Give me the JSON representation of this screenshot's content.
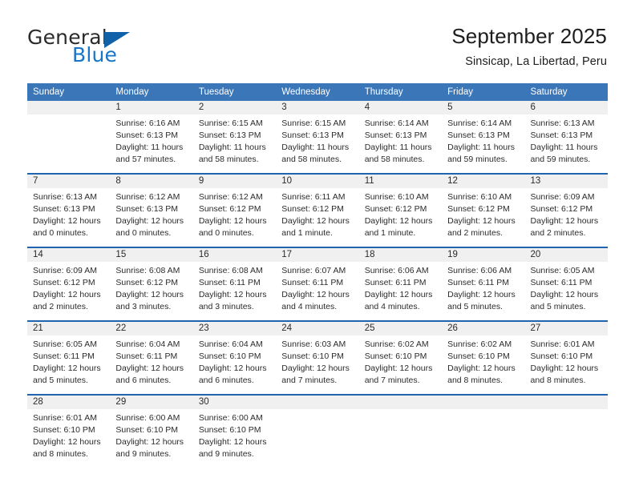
{
  "brand": {
    "line1": "General",
    "line2": "Blue",
    "logo_blue": "#1061a8",
    "logo_text_blue": "#1876c8",
    "logo_text_dark": "#2b2b2b"
  },
  "header": {
    "title": "September 2025",
    "subtitle": "Sinsicap, La Libertad, Peru"
  },
  "theme": {
    "header_row_bg": "#3b77b8",
    "header_row_text": "#ffffff",
    "week_rule": "#1f64ac",
    "day_number_band": "#f0f0f0",
    "body_text": "#2b2b2b"
  },
  "weekdays": [
    "Sunday",
    "Monday",
    "Tuesday",
    "Wednesday",
    "Thursday",
    "Friday",
    "Saturday"
  ],
  "weeks": [
    [
      {
        "day": "",
        "lines": []
      },
      {
        "day": "1",
        "lines": [
          "Sunrise: 6:16 AM",
          "Sunset: 6:13 PM",
          "Daylight: 11 hours",
          "and 57 minutes."
        ]
      },
      {
        "day": "2",
        "lines": [
          "Sunrise: 6:15 AM",
          "Sunset: 6:13 PM",
          "Daylight: 11 hours",
          "and 58 minutes."
        ]
      },
      {
        "day": "3",
        "lines": [
          "Sunrise: 6:15 AM",
          "Sunset: 6:13 PM",
          "Daylight: 11 hours",
          "and 58 minutes."
        ]
      },
      {
        "day": "4",
        "lines": [
          "Sunrise: 6:14 AM",
          "Sunset: 6:13 PM",
          "Daylight: 11 hours",
          "and 58 minutes."
        ]
      },
      {
        "day": "5",
        "lines": [
          "Sunrise: 6:14 AM",
          "Sunset: 6:13 PM",
          "Daylight: 11 hours",
          "and 59 minutes."
        ]
      },
      {
        "day": "6",
        "lines": [
          "Sunrise: 6:13 AM",
          "Sunset: 6:13 PM",
          "Daylight: 11 hours",
          "and 59 minutes."
        ]
      }
    ],
    [
      {
        "day": "7",
        "lines": [
          "Sunrise: 6:13 AM",
          "Sunset: 6:13 PM",
          "Daylight: 12 hours",
          "and 0 minutes."
        ]
      },
      {
        "day": "8",
        "lines": [
          "Sunrise: 6:12 AM",
          "Sunset: 6:13 PM",
          "Daylight: 12 hours",
          "and 0 minutes."
        ]
      },
      {
        "day": "9",
        "lines": [
          "Sunrise: 6:12 AM",
          "Sunset: 6:12 PM",
          "Daylight: 12 hours",
          "and 0 minutes."
        ]
      },
      {
        "day": "10",
        "lines": [
          "Sunrise: 6:11 AM",
          "Sunset: 6:12 PM",
          "Daylight: 12 hours",
          "and 1 minute."
        ]
      },
      {
        "day": "11",
        "lines": [
          "Sunrise: 6:10 AM",
          "Sunset: 6:12 PM",
          "Daylight: 12 hours",
          "and 1 minute."
        ]
      },
      {
        "day": "12",
        "lines": [
          "Sunrise: 6:10 AM",
          "Sunset: 6:12 PM",
          "Daylight: 12 hours",
          "and 2 minutes."
        ]
      },
      {
        "day": "13",
        "lines": [
          "Sunrise: 6:09 AM",
          "Sunset: 6:12 PM",
          "Daylight: 12 hours",
          "and 2 minutes."
        ]
      }
    ],
    [
      {
        "day": "14",
        "lines": [
          "Sunrise: 6:09 AM",
          "Sunset: 6:12 PM",
          "Daylight: 12 hours",
          "and 2 minutes."
        ]
      },
      {
        "day": "15",
        "lines": [
          "Sunrise: 6:08 AM",
          "Sunset: 6:12 PM",
          "Daylight: 12 hours",
          "and 3 minutes."
        ]
      },
      {
        "day": "16",
        "lines": [
          "Sunrise: 6:08 AM",
          "Sunset: 6:11 PM",
          "Daylight: 12 hours",
          "and 3 minutes."
        ]
      },
      {
        "day": "17",
        "lines": [
          "Sunrise: 6:07 AM",
          "Sunset: 6:11 PM",
          "Daylight: 12 hours",
          "and 4 minutes."
        ]
      },
      {
        "day": "18",
        "lines": [
          "Sunrise: 6:06 AM",
          "Sunset: 6:11 PM",
          "Daylight: 12 hours",
          "and 4 minutes."
        ]
      },
      {
        "day": "19",
        "lines": [
          "Sunrise: 6:06 AM",
          "Sunset: 6:11 PM",
          "Daylight: 12 hours",
          "and 5 minutes."
        ]
      },
      {
        "day": "20",
        "lines": [
          "Sunrise: 6:05 AM",
          "Sunset: 6:11 PM",
          "Daylight: 12 hours",
          "and 5 minutes."
        ]
      }
    ],
    [
      {
        "day": "21",
        "lines": [
          "Sunrise: 6:05 AM",
          "Sunset: 6:11 PM",
          "Daylight: 12 hours",
          "and 5 minutes."
        ]
      },
      {
        "day": "22",
        "lines": [
          "Sunrise: 6:04 AM",
          "Sunset: 6:11 PM",
          "Daylight: 12 hours",
          "and 6 minutes."
        ]
      },
      {
        "day": "23",
        "lines": [
          "Sunrise: 6:04 AM",
          "Sunset: 6:10 PM",
          "Daylight: 12 hours",
          "and 6 minutes."
        ]
      },
      {
        "day": "24",
        "lines": [
          "Sunrise: 6:03 AM",
          "Sunset: 6:10 PM",
          "Daylight: 12 hours",
          "and 7 minutes."
        ]
      },
      {
        "day": "25",
        "lines": [
          "Sunrise: 6:02 AM",
          "Sunset: 6:10 PM",
          "Daylight: 12 hours",
          "and 7 minutes."
        ]
      },
      {
        "day": "26",
        "lines": [
          "Sunrise: 6:02 AM",
          "Sunset: 6:10 PM",
          "Daylight: 12 hours",
          "and 8 minutes."
        ]
      },
      {
        "day": "27",
        "lines": [
          "Sunrise: 6:01 AM",
          "Sunset: 6:10 PM",
          "Daylight: 12 hours",
          "and 8 minutes."
        ]
      }
    ],
    [
      {
        "day": "28",
        "lines": [
          "Sunrise: 6:01 AM",
          "Sunset: 6:10 PM",
          "Daylight: 12 hours",
          "and 8 minutes."
        ]
      },
      {
        "day": "29",
        "lines": [
          "Sunrise: 6:00 AM",
          "Sunset: 6:10 PM",
          "Daylight: 12 hours",
          "and 9 minutes."
        ]
      },
      {
        "day": "30",
        "lines": [
          "Sunrise: 6:00 AM",
          "Sunset: 6:10 PM",
          "Daylight: 12 hours",
          "and 9 minutes."
        ]
      },
      {
        "day": "",
        "lines": []
      },
      {
        "day": "",
        "lines": []
      },
      {
        "day": "",
        "lines": []
      },
      {
        "day": "",
        "lines": []
      }
    ]
  ]
}
